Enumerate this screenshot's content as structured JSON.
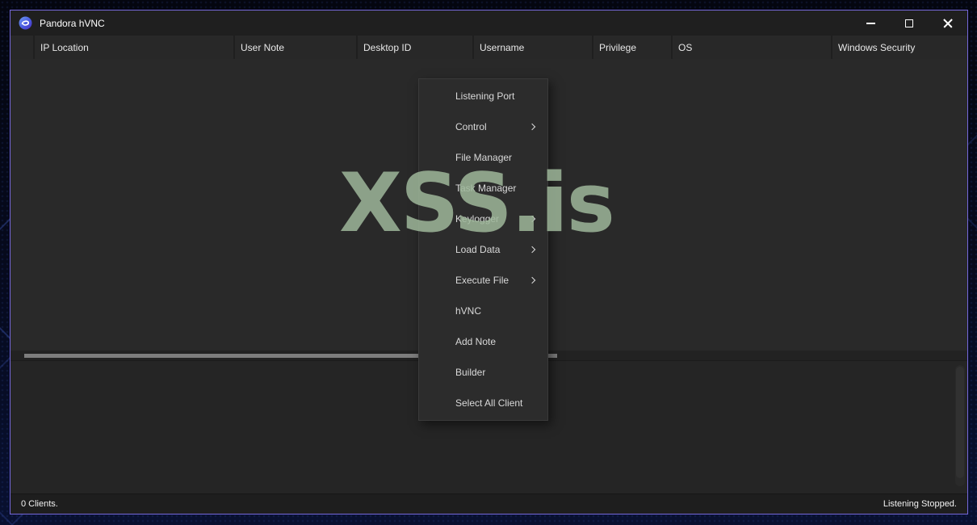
{
  "window": {
    "title": "Pandora hVNC",
    "icon": "pandora-swirl-icon",
    "controls": {
      "minimize": "minimize-icon",
      "maximize": "maximize-icon",
      "close": "close-icon"
    }
  },
  "table": {
    "columns": [
      "IP Location",
      "User Note",
      "Desktop ID",
      "Username",
      "Privilege",
      "OS",
      "Windows Security"
    ],
    "rows": []
  },
  "context_menu": {
    "items": [
      {
        "label": "Listening Port",
        "has_submenu": false
      },
      {
        "label": "Control",
        "has_submenu": true
      },
      {
        "label": "File Manager",
        "has_submenu": false
      },
      {
        "label": "Task Manager",
        "has_submenu": false
      },
      {
        "label": "Keylogger",
        "has_submenu": true
      },
      {
        "label": "Load Data",
        "has_submenu": true
      },
      {
        "label": "Execute File",
        "has_submenu": true
      },
      {
        "label": "hVNC",
        "has_submenu": false
      },
      {
        "label": "Add Note",
        "has_submenu": false
      },
      {
        "label": "Builder",
        "has_submenu": false
      },
      {
        "label": "Select All Client",
        "has_submenu": false
      }
    ]
  },
  "watermark": {
    "text": "XSS.is",
    "color": "#8ea689"
  },
  "status": {
    "left": "0 Clients.",
    "right": "Listening Stopped."
  },
  "colors": {
    "window_border": "#7568da",
    "titlebar_bg": "#1f1f1f",
    "header_cell_bg": "#282828",
    "list_bg": "#292929",
    "menu_bg": "#2c2c2c",
    "watermark_green": "#8ea689"
  }
}
